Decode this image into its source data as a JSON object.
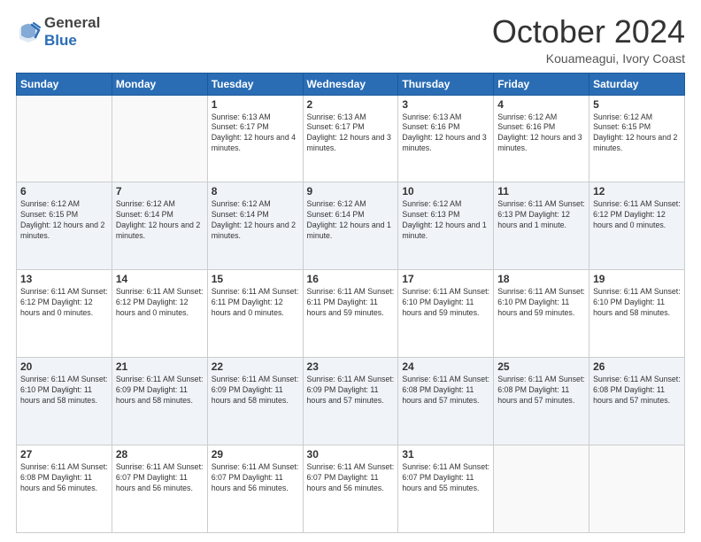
{
  "header": {
    "logo_general": "General",
    "logo_blue": "Blue",
    "month_title": "October 2024",
    "location": "Kouameagui, Ivory Coast"
  },
  "days_of_week": [
    "Sunday",
    "Monday",
    "Tuesday",
    "Wednesday",
    "Thursday",
    "Friday",
    "Saturday"
  ],
  "weeks": [
    [
      {
        "day": "",
        "info": ""
      },
      {
        "day": "",
        "info": ""
      },
      {
        "day": "1",
        "info": "Sunrise: 6:13 AM\nSunset: 6:17 PM\nDaylight: 12 hours and 4 minutes."
      },
      {
        "day": "2",
        "info": "Sunrise: 6:13 AM\nSunset: 6:17 PM\nDaylight: 12 hours and 3 minutes."
      },
      {
        "day": "3",
        "info": "Sunrise: 6:13 AM\nSunset: 6:16 PM\nDaylight: 12 hours and 3 minutes."
      },
      {
        "day": "4",
        "info": "Sunrise: 6:12 AM\nSunset: 6:16 PM\nDaylight: 12 hours and 3 minutes."
      },
      {
        "day": "5",
        "info": "Sunrise: 6:12 AM\nSunset: 6:15 PM\nDaylight: 12 hours and 2 minutes."
      }
    ],
    [
      {
        "day": "6",
        "info": "Sunrise: 6:12 AM\nSunset: 6:15 PM\nDaylight: 12 hours and 2 minutes."
      },
      {
        "day": "7",
        "info": "Sunrise: 6:12 AM\nSunset: 6:14 PM\nDaylight: 12 hours and 2 minutes."
      },
      {
        "day": "8",
        "info": "Sunrise: 6:12 AM\nSunset: 6:14 PM\nDaylight: 12 hours and 2 minutes."
      },
      {
        "day": "9",
        "info": "Sunrise: 6:12 AM\nSunset: 6:14 PM\nDaylight: 12 hours and 1 minute."
      },
      {
        "day": "10",
        "info": "Sunrise: 6:12 AM\nSunset: 6:13 PM\nDaylight: 12 hours and 1 minute."
      },
      {
        "day": "11",
        "info": "Sunrise: 6:11 AM\nSunset: 6:13 PM\nDaylight: 12 hours and 1 minute."
      },
      {
        "day": "12",
        "info": "Sunrise: 6:11 AM\nSunset: 6:12 PM\nDaylight: 12 hours and 0 minutes."
      }
    ],
    [
      {
        "day": "13",
        "info": "Sunrise: 6:11 AM\nSunset: 6:12 PM\nDaylight: 12 hours and 0 minutes."
      },
      {
        "day": "14",
        "info": "Sunrise: 6:11 AM\nSunset: 6:12 PM\nDaylight: 12 hours and 0 minutes."
      },
      {
        "day": "15",
        "info": "Sunrise: 6:11 AM\nSunset: 6:11 PM\nDaylight: 12 hours and 0 minutes."
      },
      {
        "day": "16",
        "info": "Sunrise: 6:11 AM\nSunset: 6:11 PM\nDaylight: 11 hours and 59 minutes."
      },
      {
        "day": "17",
        "info": "Sunrise: 6:11 AM\nSunset: 6:10 PM\nDaylight: 11 hours and 59 minutes."
      },
      {
        "day": "18",
        "info": "Sunrise: 6:11 AM\nSunset: 6:10 PM\nDaylight: 11 hours and 59 minutes."
      },
      {
        "day": "19",
        "info": "Sunrise: 6:11 AM\nSunset: 6:10 PM\nDaylight: 11 hours and 58 minutes."
      }
    ],
    [
      {
        "day": "20",
        "info": "Sunrise: 6:11 AM\nSunset: 6:10 PM\nDaylight: 11 hours and 58 minutes."
      },
      {
        "day": "21",
        "info": "Sunrise: 6:11 AM\nSunset: 6:09 PM\nDaylight: 11 hours and 58 minutes."
      },
      {
        "day": "22",
        "info": "Sunrise: 6:11 AM\nSunset: 6:09 PM\nDaylight: 11 hours and 58 minutes."
      },
      {
        "day": "23",
        "info": "Sunrise: 6:11 AM\nSunset: 6:09 PM\nDaylight: 11 hours and 57 minutes."
      },
      {
        "day": "24",
        "info": "Sunrise: 6:11 AM\nSunset: 6:08 PM\nDaylight: 11 hours and 57 minutes."
      },
      {
        "day": "25",
        "info": "Sunrise: 6:11 AM\nSunset: 6:08 PM\nDaylight: 11 hours and 57 minutes."
      },
      {
        "day": "26",
        "info": "Sunrise: 6:11 AM\nSunset: 6:08 PM\nDaylight: 11 hours and 57 minutes."
      }
    ],
    [
      {
        "day": "27",
        "info": "Sunrise: 6:11 AM\nSunset: 6:08 PM\nDaylight: 11 hours and 56 minutes."
      },
      {
        "day": "28",
        "info": "Sunrise: 6:11 AM\nSunset: 6:07 PM\nDaylight: 11 hours and 56 minutes."
      },
      {
        "day": "29",
        "info": "Sunrise: 6:11 AM\nSunset: 6:07 PM\nDaylight: 11 hours and 56 minutes."
      },
      {
        "day": "30",
        "info": "Sunrise: 6:11 AM\nSunset: 6:07 PM\nDaylight: 11 hours and 56 minutes."
      },
      {
        "day": "31",
        "info": "Sunrise: 6:11 AM\nSunset: 6:07 PM\nDaylight: 11 hours and 55 minutes."
      },
      {
        "day": "",
        "info": ""
      },
      {
        "day": "",
        "info": ""
      }
    ]
  ]
}
